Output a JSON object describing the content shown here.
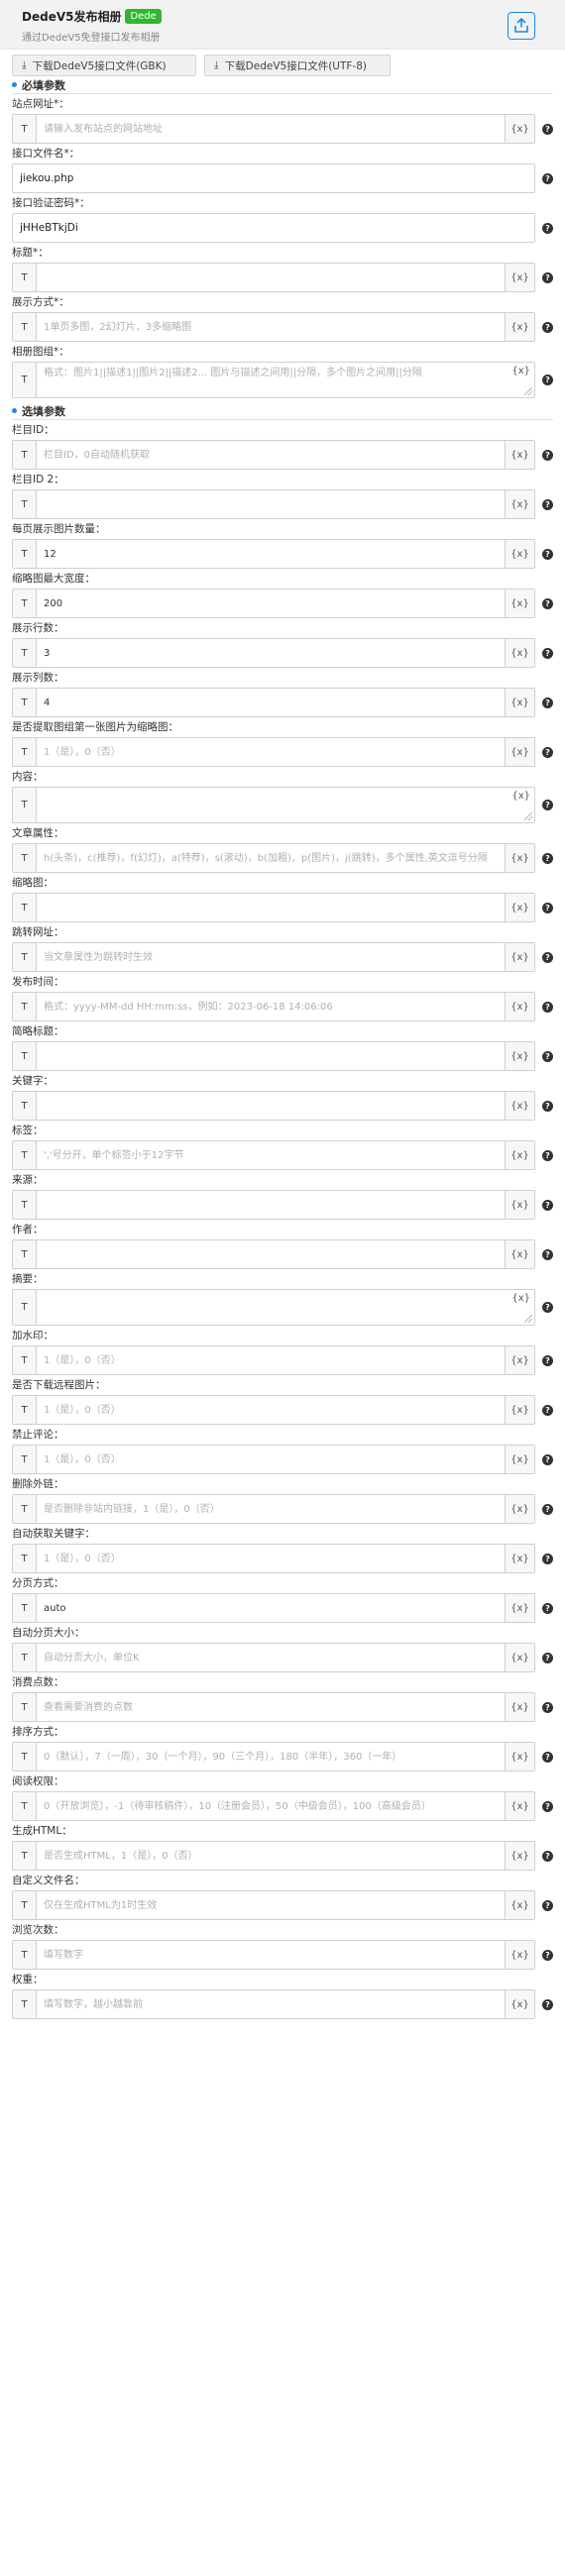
{
  "header": {
    "title": "DedeV5发布相册",
    "badge": "Dede",
    "subtitle": "通过DedeV5免登接口发布相册",
    "publish_icon": "upload-cloud-icon"
  },
  "downloads": [
    {
      "label": "下载DedeV5接口文件(GBK)",
      "icon": "download-icon"
    },
    {
      "label": "下载DedeV5接口文件(UTF-8)",
      "icon": "download-icon"
    }
  ],
  "sections": {
    "required": "必填参数",
    "optional": "选填参数"
  },
  "colors": {
    "accent": "#1e88e5",
    "badge": "#2eb82e"
  },
  "t_label": "T",
  "var_label": "{x}",
  "help_label": "?",
  "required_fields": [
    {
      "label": "站点网址*：",
      "type": "tvar",
      "value": "",
      "placeholder": "请输入发布站点的网站地址"
    },
    {
      "label": "接口文件名*：",
      "type": "plain",
      "value": "jiekou.php",
      "placeholder": ""
    },
    {
      "label": "接口验证密码*：",
      "type": "plain",
      "value": "jHHeBTkjDi",
      "placeholder": ""
    },
    {
      "label": "标题*：",
      "type": "tvar",
      "value": "",
      "placeholder": ""
    },
    {
      "label": "展示方式*：",
      "type": "tvar",
      "value": "",
      "placeholder": "1单页多图，2幻灯片，3多缩略图"
    },
    {
      "label": "相册图组*：",
      "type": "textarea",
      "value": "",
      "placeholder": "格式：图片1||描述1||图片2||描述2... 图片与描述之间用||分隔，多个图片之间用||分隔"
    }
  ],
  "optional_fields": [
    {
      "label": "栏目ID：",
      "type": "tvar",
      "value": "",
      "placeholder": "栏目ID，0自动随机获取"
    },
    {
      "label": "栏目ID 2：",
      "type": "tvar",
      "value": "",
      "placeholder": ""
    },
    {
      "label": "每页展示图片数量：",
      "type": "tvar",
      "value": "12",
      "placeholder": ""
    },
    {
      "label": "缩略图最大宽度：",
      "type": "tvar",
      "value": "200",
      "placeholder": ""
    },
    {
      "label": "展示行数：",
      "type": "tvar",
      "value": "3",
      "placeholder": ""
    },
    {
      "label": "展示列数：",
      "type": "tvar",
      "value": "4",
      "placeholder": ""
    },
    {
      "label": "是否提取图组第一张图片为缩略图：",
      "type": "tvar",
      "value": "",
      "placeholder": "1（是），0（否）"
    },
    {
      "label": "内容：",
      "type": "textarea",
      "value": "",
      "placeholder": ""
    },
    {
      "label": "文章属性：",
      "type": "tvar",
      "value": "",
      "placeholder": "h(头条)，c(推荐)，f(幻灯)，a(特荐)，s(滚动)，b(加粗)，p(图片)，j(跳转)，多个属性,英文逗号分隔"
    },
    {
      "label": "缩略图：",
      "type": "tvar",
      "value": "",
      "placeholder": ""
    },
    {
      "label": "跳转网址：",
      "type": "tvar",
      "value": "",
      "placeholder": "当文章属性为跳转时生效"
    },
    {
      "label": "发布时间：",
      "type": "tvar",
      "value": "",
      "placeholder": "格式：yyyy-MM-dd HH:mm:ss，例如：2023-06-18 14:06:06"
    },
    {
      "label": "简略标题：",
      "type": "tvar",
      "value": "",
      "placeholder": ""
    },
    {
      "label": "关键字：",
      "type": "tvar",
      "value": "",
      "placeholder": ""
    },
    {
      "label": "标签：",
      "type": "tvar",
      "value": "",
      "placeholder": "','号分开，单个标签小于12字节"
    },
    {
      "label": "来源：",
      "type": "tvar",
      "value": "",
      "placeholder": ""
    },
    {
      "label": "作者：",
      "type": "tvar",
      "value": "",
      "placeholder": ""
    },
    {
      "label": "摘要：",
      "type": "textarea",
      "value": "",
      "placeholder": ""
    },
    {
      "label": "加水印：",
      "type": "tvar",
      "value": "",
      "placeholder": "1（是），0（否）"
    },
    {
      "label": "是否下载远程图片：",
      "type": "tvar",
      "value": "",
      "placeholder": "1（是），0（否）"
    },
    {
      "label": "禁止评论：",
      "type": "tvar",
      "value": "",
      "placeholder": "1（是），0（否）"
    },
    {
      "label": "删除外链：",
      "type": "tvar",
      "value": "",
      "placeholder": "是否删除非站内链接，1（是），0（否）"
    },
    {
      "label": "自动获取关键字：",
      "type": "tvar",
      "value": "",
      "placeholder": "1（是），0（否）"
    },
    {
      "label": "分页方式：",
      "type": "tvar",
      "value": "auto",
      "placeholder": ""
    },
    {
      "label": "自动分页大小：",
      "type": "tvar",
      "value": "",
      "placeholder": "自动分页大小，单位K"
    },
    {
      "label": "消费点数：",
      "type": "tvar",
      "value": "",
      "placeholder": "查看需要消费的点数"
    },
    {
      "label": "排序方式：",
      "type": "tvar",
      "value": "",
      "placeholder": "0（默认），7（一周），30（一个月），90（三个月），180（半年），360（一年）"
    },
    {
      "label": "阅读权限：",
      "type": "tvar",
      "value": "",
      "placeholder": "0（开放浏览），-1（待审核稿件），10（注册会员），50（中级会员），100（高级会员）"
    },
    {
      "label": "生成HTML：",
      "type": "tvar",
      "value": "",
      "placeholder": "是否生成HTML，1（是），0（否）"
    },
    {
      "label": "自定义文件名：",
      "type": "tvar",
      "value": "",
      "placeholder": "仅在生成HTML为1时生效"
    },
    {
      "label": "浏览次数：",
      "type": "tvar",
      "value": "",
      "placeholder": "填写数字"
    },
    {
      "label": "权重：",
      "type": "tvar",
      "value": "",
      "placeholder": "填写数字，越小越靠前"
    }
  ]
}
